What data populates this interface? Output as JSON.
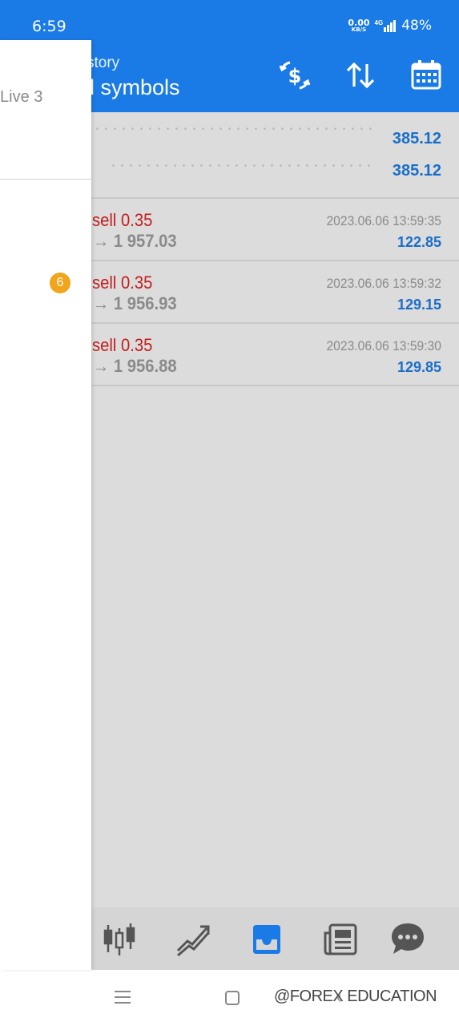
{
  "status_bar": {
    "time": "6:59",
    "net_speed_value": "0.00",
    "net_speed_unit": "KB/S",
    "network": "4G",
    "battery": "48%"
  },
  "header": {
    "subtitle": "story",
    "title": "l symbols",
    "icons": [
      "currency-exchange-icon",
      "sort-icon",
      "calendar-icon"
    ]
  },
  "summary": {
    "row1_value": "385.12",
    "row2_value": "385.12"
  },
  "deals": [
    {
      "type": "sell 0.35",
      "price": "→ 1 957.03",
      "time": "2023.06.06 13:59:35",
      "profit": "122.85"
    },
    {
      "type": "sell 0.35",
      "price": "→ 1 956.93",
      "time": "2023.06.06 13:59:32",
      "profit": "129.15"
    },
    {
      "type": "sell 0.35",
      "price": "→ 1 956.88",
      "time": "2023.06.06 13:59:30",
      "profit": "129.85"
    }
  ],
  "drawer": {
    "account_label": "Live 3",
    "badge_count": "6"
  },
  "tabbar": {
    "tabs": [
      "quotes-icon",
      "chart-icon",
      "history-icon",
      "news-icon",
      "chat-icon"
    ],
    "active": "history-icon"
  },
  "watermark": "@FOREX EDUCATION",
  "colors": {
    "accent": "#1a7ae6",
    "sell": "#c31b1b",
    "profit": "#1a6ec8",
    "badge": "#f0a51c"
  }
}
